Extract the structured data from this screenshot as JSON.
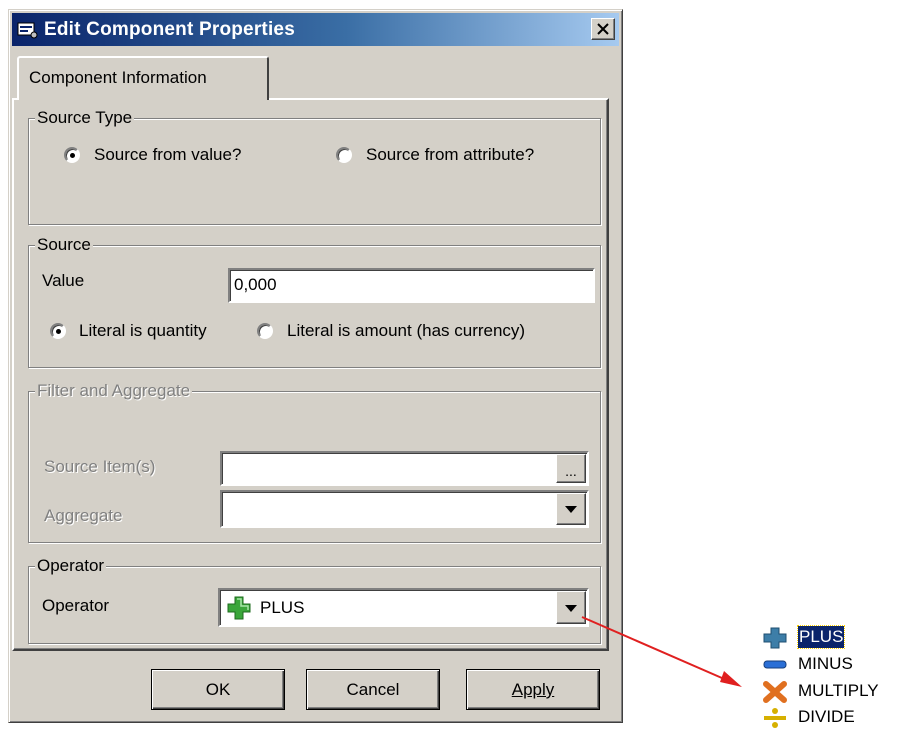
{
  "window": {
    "title": "Edit Component Properties"
  },
  "tabs": [
    {
      "label": "Component Information"
    }
  ],
  "source_type": {
    "legend": "Source Type",
    "options": [
      {
        "label": "Source from value?",
        "checked": true
      },
      {
        "label": "Source from attribute?",
        "checked": false
      }
    ]
  },
  "source": {
    "legend": "Source",
    "value_label": "Value",
    "value": "0,000",
    "options": [
      {
        "label": "Literal is quantity",
        "checked": true
      },
      {
        "label": "Literal is amount (has currency)",
        "checked": false
      }
    ]
  },
  "filter_aggregate": {
    "legend": "Filter and Aggregate",
    "source_items_label": "Source Item(s)",
    "source_items_value": "",
    "browse_label": "...",
    "aggregate_label": "Aggregate",
    "aggregate_value": ""
  },
  "operator": {
    "legend": "Operator",
    "label": "Operator",
    "selected": "PLUS",
    "selected_icon": "plus-icon"
  },
  "buttons": {
    "ok": "OK",
    "cancel": "Cancel",
    "apply": "Apply"
  },
  "operator_options": [
    {
      "label": "PLUS",
      "icon": "plus-icon",
      "selected": true
    },
    {
      "label": "MINUS",
      "icon": "minus-icon",
      "selected": false
    },
    {
      "label": "MULTIPLY",
      "icon": "multiply-icon",
      "selected": false
    },
    {
      "label": "DIVIDE",
      "icon": "divide-icon",
      "selected": false
    }
  ],
  "colors": {
    "titlebar_start": "#0a246a",
    "titlebar_end": "#a6caf0",
    "dialog_face": "#d4d0c8",
    "arrow": "#e02020"
  }
}
